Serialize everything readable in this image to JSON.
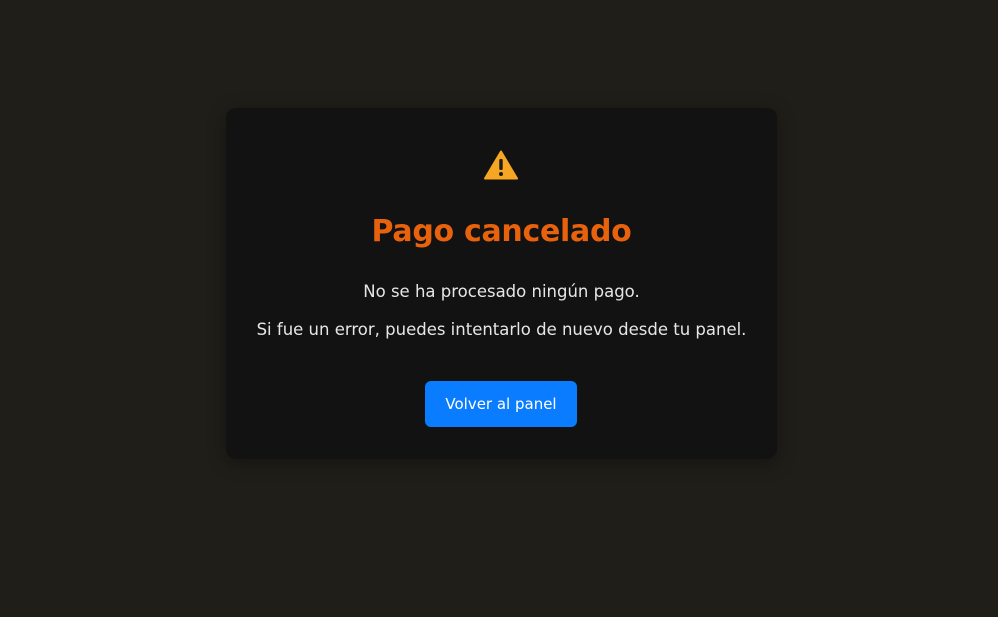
{
  "card": {
    "icon": "warning-icon",
    "title": "Pago cancelado",
    "message_line1": "No se ha procesado ningún pago.",
    "message_line2": "Si fue un error, puedes intentarlo de nuevo desde tu panel.",
    "button_label": "Volver al panel"
  },
  "colors": {
    "background": "#201e19",
    "card": "#121212",
    "title": "#e8620e",
    "warning_icon": "#f5a623",
    "button": "#0a7cff"
  }
}
